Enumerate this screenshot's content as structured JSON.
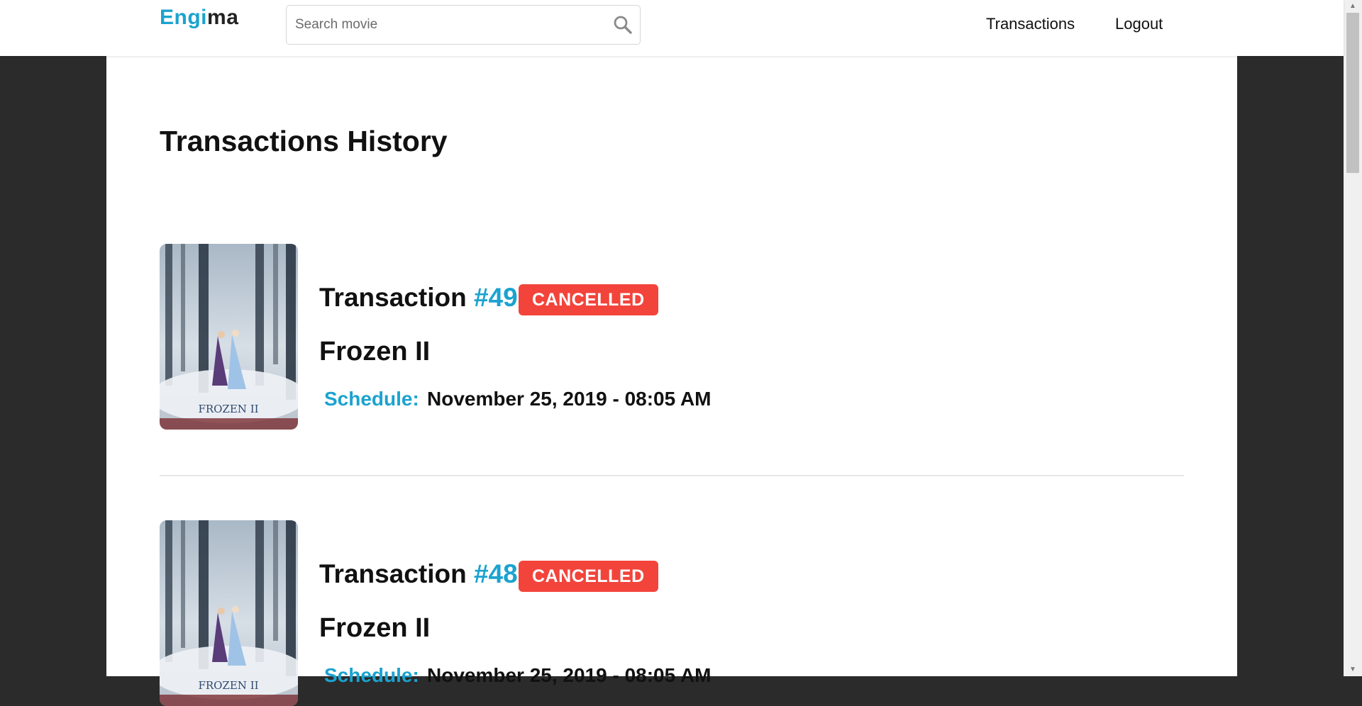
{
  "header": {
    "logo": {
      "part1": "Eng",
      "part2": "i",
      "part3": "ma"
    },
    "search": {
      "placeholder": "Search movie",
      "value": ""
    },
    "nav": {
      "transactions": "Transactions",
      "logout": "Logout"
    }
  },
  "page": {
    "title": "Transactions History"
  },
  "transactions": [
    {
      "label": "Transaction",
      "number": "#49",
      "status": "CANCELLED",
      "movie": "Frozen II",
      "poster_text": "FROZEN II",
      "schedule_label": "Schedule:",
      "schedule_value": "November 25, 2019 - 08:05 AM"
    },
    {
      "label": "Transaction",
      "number": "#48",
      "status": "CANCELLED",
      "movie": "Frozen II",
      "poster_text": "FROZEN II",
      "schedule_label": "Schedule:",
      "schedule_value": "November 25, 2019 - 08:05 AM"
    }
  ],
  "colors": {
    "accent": "#1ba3cf",
    "badge_cancelled": "#f2443b",
    "page_background": "#2b2b2b"
  }
}
